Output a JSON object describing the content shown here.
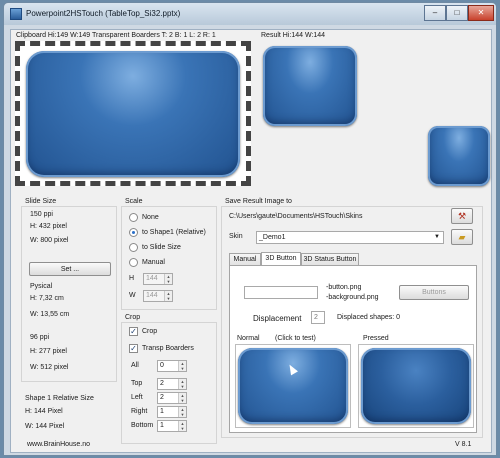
{
  "window": {
    "title": "Powerpoint2HSTouch (TableTop_Si32.pptx)",
    "min": "–",
    "max": "□",
    "close": "✕"
  },
  "clipboard": {
    "header": "Clipboard  Hi:149 W:149   Transparent Boarders T: 2 B: 1 L: 2 R: 1"
  },
  "result": {
    "header": "Result  Hi:144 W:144"
  },
  "slide_size": {
    "title": "Slide Size",
    "ppi": "150 ppi",
    "h": "H: 432 pixel",
    "w": "W: 800 pixel",
    "set_button": "Set ...",
    "physical": "Pysical",
    "h_cm": "H: 7,32 cm",
    "w_cm": "W: 13,55 cm",
    "ppi2": "96 ppi",
    "h2": "H: 277 pixel",
    "w2": "W: 512 pixel"
  },
  "shape_relative": {
    "title": "Shape 1 Relative Size",
    "h": "H: 144 Pixel",
    "w": "W: 144 Pixel"
  },
  "scale": {
    "title": "Scale",
    "opt_none": "None",
    "opt_shape": "to Shape1  (Relative)",
    "opt_slide": "to Slide Size",
    "opt_manual": "Manual",
    "h_label": "H",
    "h_value": "144",
    "w_label": "W",
    "w_value": "144"
  },
  "crop": {
    "title": "Crop",
    "crop_label": "Crop",
    "transp_label": "Transp Boarders",
    "all_label": "All",
    "all_value": "0",
    "top_label": "Top",
    "top_value": "2",
    "left_label": "Left",
    "left_value": "2",
    "right_label": "Right",
    "right_value": "1",
    "bottom_label": "Bottom",
    "bottom_value": "1"
  },
  "save": {
    "title": "Save Result Image to",
    "path": "C:\\Users\\gaute\\Documents\\HSTouch\\Skins",
    "skin_label": "Skin",
    "skin_value": "_Demo1"
  },
  "tabs": [
    "Manual",
    "3D Button",
    "3D Status Button"
  ],
  "button_tab": {
    "name_value": "",
    "file1": "-button.png",
    "file2": "-background.png",
    "buttons_btn": "Buttons",
    "displacement_label": "Displacement",
    "displacement_value": "2",
    "displaced_shapes": "Displaced shapes: 0",
    "normal_label": "Normal",
    "click_hint": "(Click to test)",
    "pressed_label": "Pressed"
  },
  "footer": {
    "website": "www.BrainHouse.no",
    "version": "V 8.1"
  }
}
